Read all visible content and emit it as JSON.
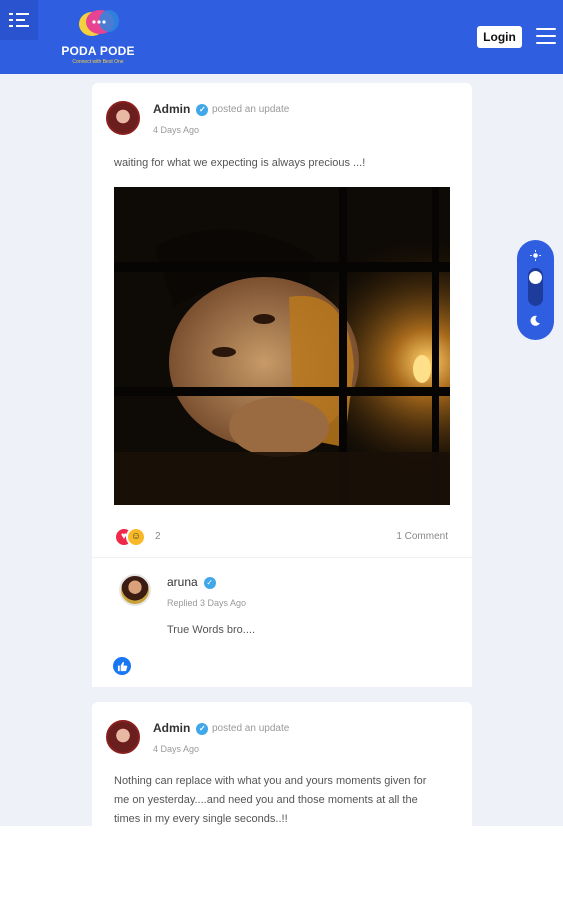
{
  "header": {
    "brand_name": "PODA PODE",
    "brand_tagline": "Connect with Best One",
    "login_label": "Login",
    "bubble_colors": [
      "#f4d03f",
      "#e84393",
      "#2e86de"
    ]
  },
  "posts": [
    {
      "author": "Admin",
      "action": "posted an update",
      "time": "4 Days Ago",
      "text": "waiting for what we expecting is always precious ...!",
      "reaction_count": "2",
      "comment_count": "1 Comment",
      "comment": {
        "author": "aruna",
        "time": "Replied 3 Days Ago",
        "text": "True Words bro...."
      }
    },
    {
      "author": "Admin",
      "action": "posted an update",
      "time": "4 Days Ago",
      "text_lines": [
        "Nothing can replace with what you and yours moments given for",
        "me on yesterday....and need you and those moments at all the",
        "times in my every single seconds..!!"
      ]
    }
  ],
  "colors": {
    "brand_blue": "#2f5ee0",
    "verified_blue": "#3fa7ea",
    "love_red": "#f02849",
    "like_blue": "#1877f2"
  },
  "icons": [
    "sidebar-toggle-icon",
    "hamburger-menu-icon",
    "verified-icon",
    "love-reaction-icon",
    "laugh-reaction-icon",
    "like-icon",
    "sun-icon",
    "moon-icon"
  ]
}
